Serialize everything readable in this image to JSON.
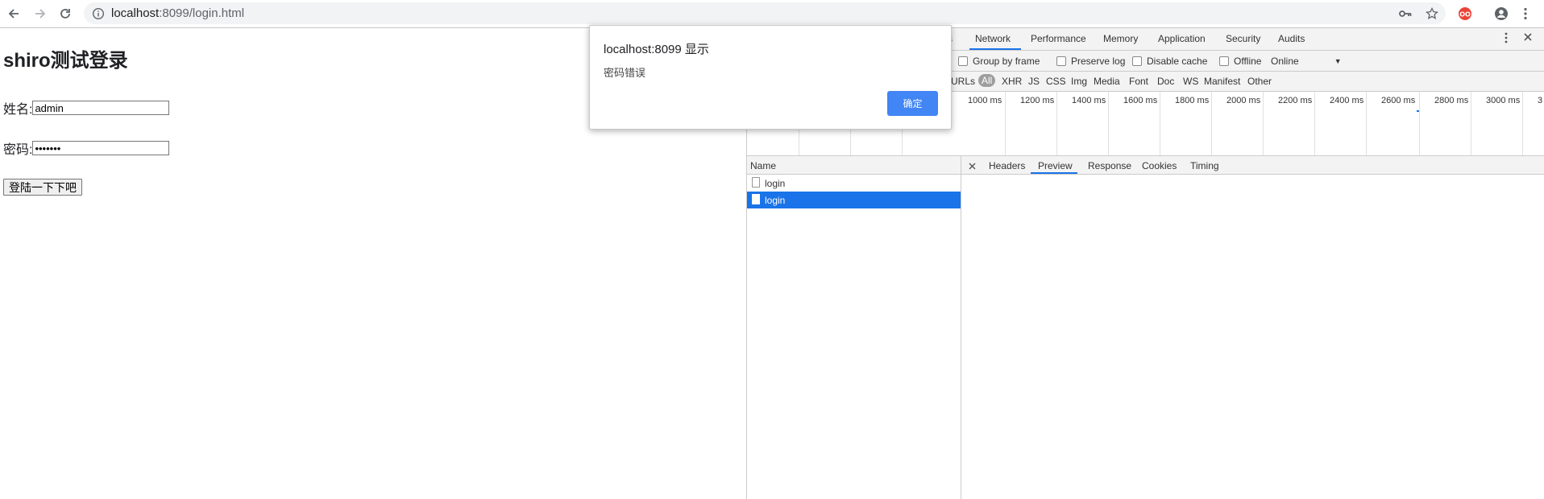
{
  "browser": {
    "url_host": "localhost",
    "url_rest": ":8099/login.html"
  },
  "page": {
    "title": "shiro测试登录",
    "name_label": "姓名:",
    "name_value": "admin",
    "password_label": "密码:",
    "password_value": "•••••••",
    "login_button": "登陆一下下吧"
  },
  "alert": {
    "title": "localhost:8099 显示",
    "message": "密码错误",
    "ok_label": "确定",
    "ok_color": "#4285f4"
  },
  "devtools": {
    "tabs": [
      "s",
      "Network",
      "Performance",
      "Memory",
      "Application",
      "Security",
      "Audits"
    ],
    "active_tab": "Network",
    "toolbar": {
      "group_by_frame": "Group by frame",
      "preserve_log": "Preserve log",
      "disable_cache": "Disable cache",
      "offline": "Offline",
      "online": "Online"
    },
    "filters": [
      "URLs",
      "All",
      "XHR",
      "JS",
      "CSS",
      "Img",
      "Media",
      "Font",
      "Doc",
      "WS",
      "Manifest",
      "Other"
    ],
    "active_filter": "All",
    "timeline_ticks": [
      "1000 ms",
      "1200 ms",
      "1400 ms",
      "1600 ms",
      "1800 ms",
      "2000 ms",
      "2200 ms",
      "2400 ms",
      "2600 ms",
      "2800 ms",
      "3000 ms",
      "3"
    ],
    "name_header": "Name",
    "requests": [
      {
        "name": "login",
        "selected": false
      },
      {
        "name": "login",
        "selected": true
      }
    ],
    "detail_tabs": [
      "Headers",
      "Preview",
      "Response",
      "Cookies",
      "Timing"
    ],
    "active_detail_tab": "Preview",
    "accent_color": "#1a73e8"
  }
}
